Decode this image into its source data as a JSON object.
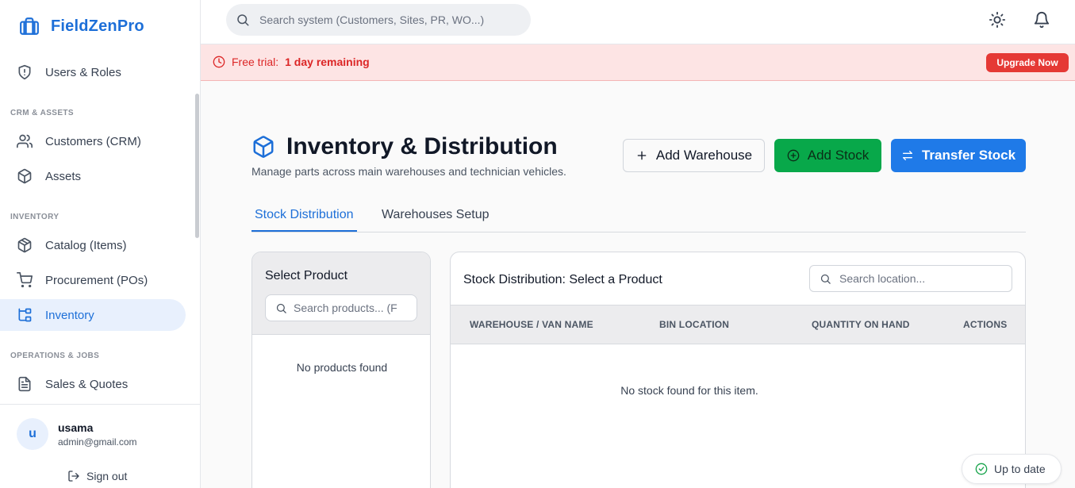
{
  "app": {
    "name": "FieldZenPro"
  },
  "sidebar": {
    "top_items": [
      {
        "label": "Users & Roles",
        "icon": "shield-icon"
      }
    ],
    "sections": [
      {
        "title": "CRM & ASSETS",
        "items": [
          {
            "label": "Customers (CRM)",
            "icon": "users-icon"
          },
          {
            "label": "Assets",
            "icon": "box-icon"
          }
        ]
      },
      {
        "title": "INVENTORY",
        "items": [
          {
            "label": "Catalog (Items)",
            "icon": "package-icon"
          },
          {
            "label": "Procurement (POs)",
            "icon": "cart-icon"
          },
          {
            "label": "Inventory",
            "icon": "hierarchy-icon",
            "active": true
          }
        ]
      },
      {
        "title": "OPERATIONS & JOBS",
        "items": [
          {
            "label": "Sales & Quotes",
            "icon": "document-icon"
          }
        ]
      }
    ],
    "user": {
      "avatar_letter": "u",
      "name": "usama",
      "email": "admin@gmail.com",
      "sign_out": "Sign out"
    }
  },
  "topbar": {
    "search_placeholder": "Search system (Customers, Sites, PR, WO...)"
  },
  "trial": {
    "prefix": "Free trial:",
    "remaining": "1 day remaining",
    "upgrade_label": "Upgrade Now"
  },
  "page": {
    "title": "Inventory & Distribution",
    "subtitle": "Manage parts across main warehouses and technician vehicles.",
    "buttons": {
      "add_warehouse": "Add Warehouse",
      "add_stock": "Add Stock",
      "transfer_stock": "Transfer Stock"
    },
    "tabs": [
      {
        "label": "Stock Distribution",
        "active": true
      },
      {
        "label": "Warehouses Setup",
        "active": false
      }
    ]
  },
  "product_panel": {
    "title": "Select Product",
    "search_placeholder": "Search products... (F",
    "empty": "No products found"
  },
  "stock_panel": {
    "title": "Stock Distribution: Select a Product",
    "search_placeholder": "Search location...",
    "columns": [
      "WAREHOUSE / VAN NAME",
      "BIN LOCATION",
      "QUANTITY ON HAND",
      "ACTIONS"
    ],
    "empty": "No stock found for this item."
  },
  "status": {
    "label": "Up to date"
  },
  "colors": {
    "accent": "#1d6fd8",
    "danger": "#e53935",
    "success": "#08a84a",
    "primary_button": "#1f7ae8"
  }
}
